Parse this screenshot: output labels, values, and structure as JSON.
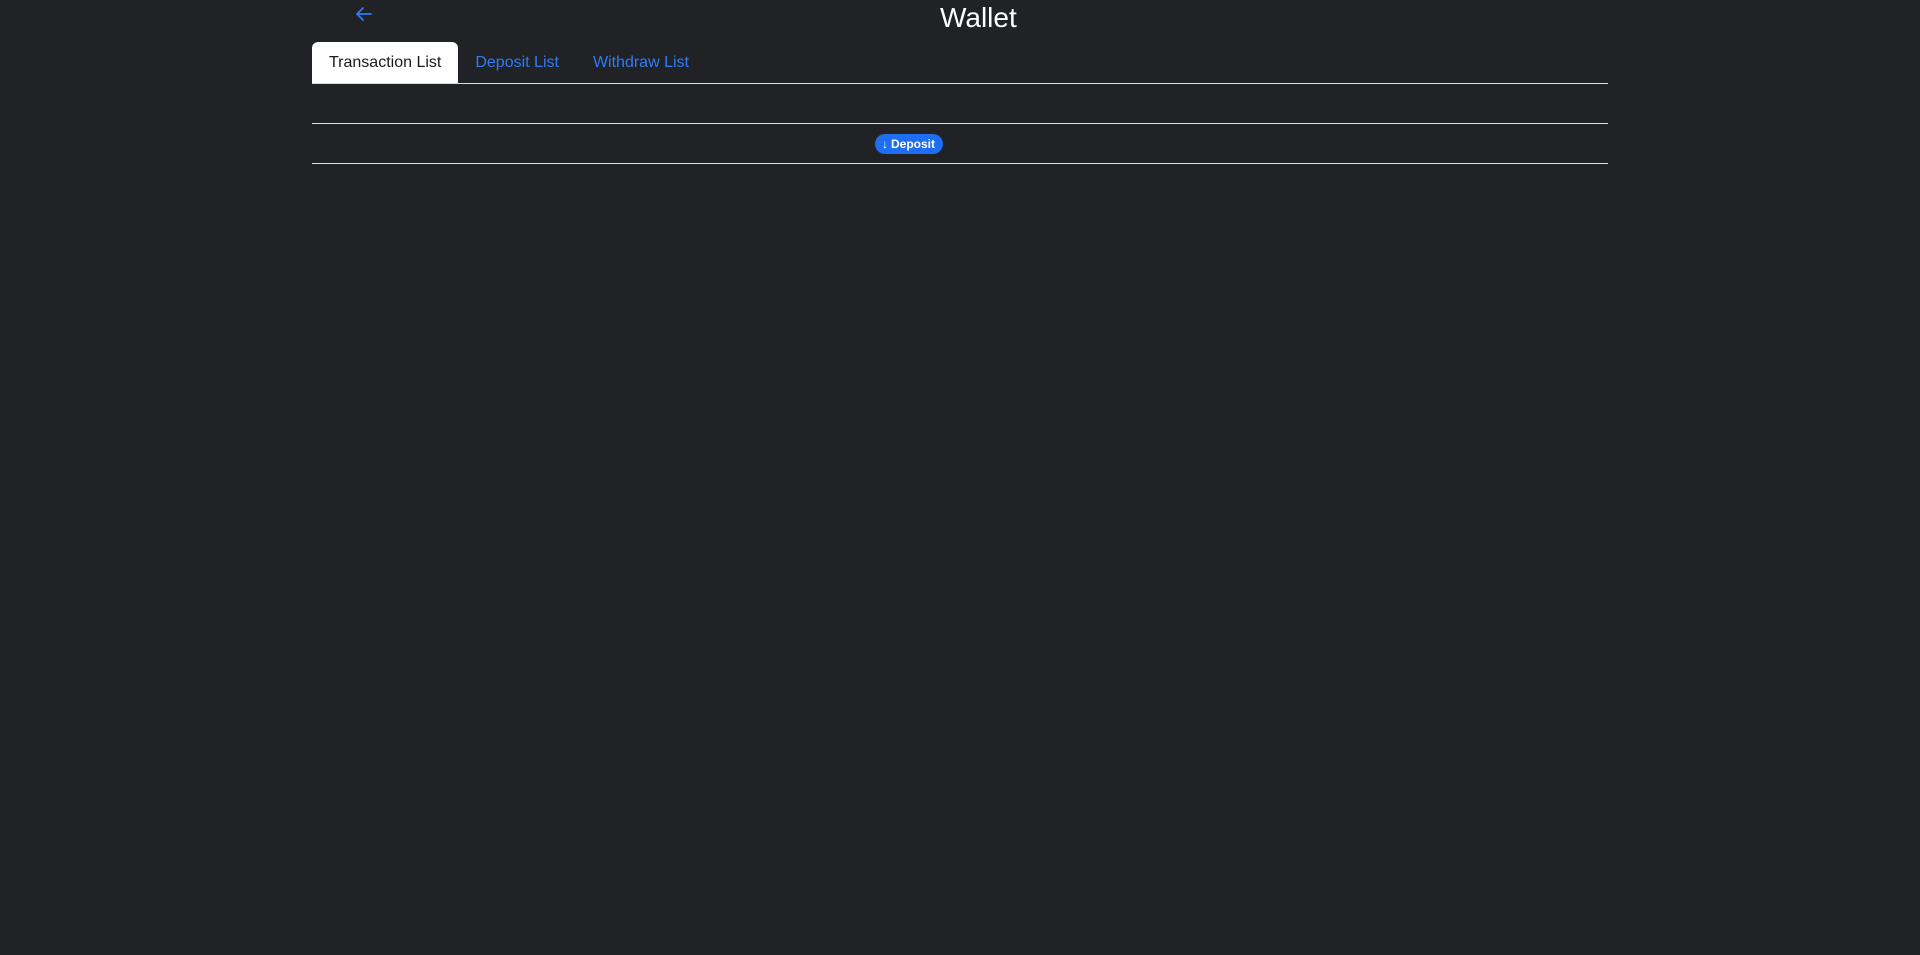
{
  "header": {
    "title": "Wallet",
    "back_icon": "arrow-left-icon"
  },
  "tabs": [
    {
      "label": "Transaction List",
      "active": true
    },
    {
      "label": "Deposit List",
      "active": false
    },
    {
      "label": "Withdraw List",
      "active": false
    }
  ],
  "table": {
    "headers": [
      "",
      "",
      "",
      ""
    ],
    "rows": [
      {
        "col0": "",
        "col1": "",
        "type_badge": {
          "label": "Deposit",
          "icon": "arrow-down-icon",
          "color": "#1d6ef2"
        },
        "col3": ""
      }
    ]
  },
  "colors": {
    "background": "#212226",
    "accent": "#2f7cf6",
    "badge": "#1d6ef2"
  }
}
